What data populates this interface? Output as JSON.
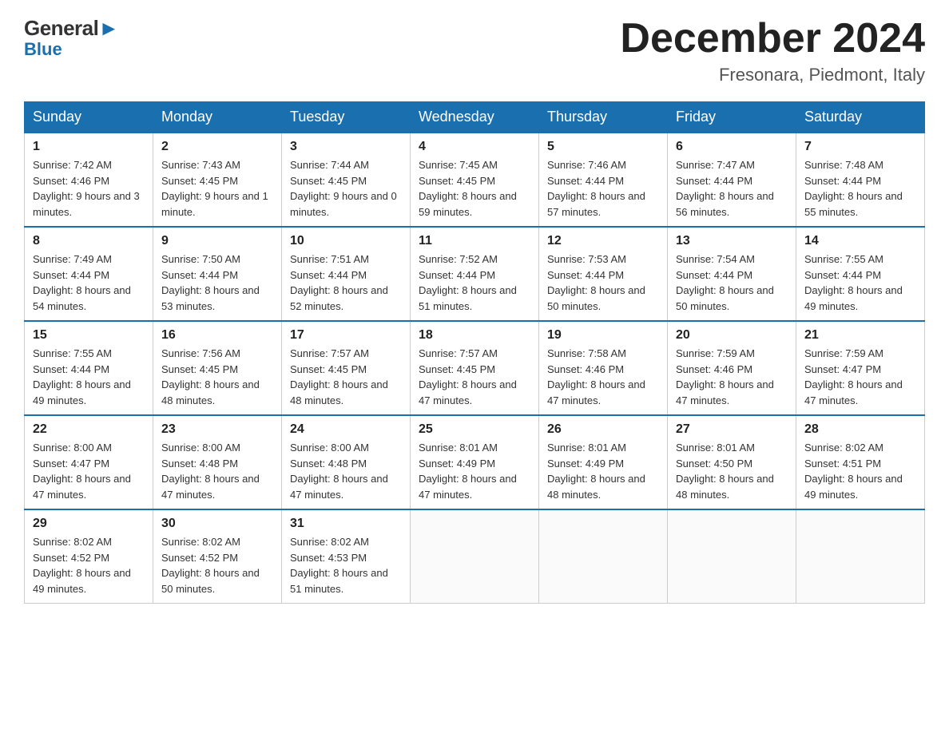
{
  "logo": {
    "line1": "General",
    "line2": "Blue"
  },
  "title": {
    "month_year": "December 2024",
    "location": "Fresonara, Piedmont, Italy"
  },
  "days_of_week": [
    "Sunday",
    "Monday",
    "Tuesday",
    "Wednesday",
    "Thursday",
    "Friday",
    "Saturday"
  ],
  "weeks": [
    [
      {
        "day": "1",
        "sunrise": "7:42 AM",
        "sunset": "4:46 PM",
        "daylight": "9 hours and 3 minutes."
      },
      {
        "day": "2",
        "sunrise": "7:43 AM",
        "sunset": "4:45 PM",
        "daylight": "9 hours and 1 minute."
      },
      {
        "day": "3",
        "sunrise": "7:44 AM",
        "sunset": "4:45 PM",
        "daylight": "9 hours and 0 minutes."
      },
      {
        "day": "4",
        "sunrise": "7:45 AM",
        "sunset": "4:45 PM",
        "daylight": "8 hours and 59 minutes."
      },
      {
        "day": "5",
        "sunrise": "7:46 AM",
        "sunset": "4:44 PM",
        "daylight": "8 hours and 57 minutes."
      },
      {
        "day": "6",
        "sunrise": "7:47 AM",
        "sunset": "4:44 PM",
        "daylight": "8 hours and 56 minutes."
      },
      {
        "day": "7",
        "sunrise": "7:48 AM",
        "sunset": "4:44 PM",
        "daylight": "8 hours and 55 minutes."
      }
    ],
    [
      {
        "day": "8",
        "sunrise": "7:49 AM",
        "sunset": "4:44 PM",
        "daylight": "8 hours and 54 minutes."
      },
      {
        "day": "9",
        "sunrise": "7:50 AM",
        "sunset": "4:44 PM",
        "daylight": "8 hours and 53 minutes."
      },
      {
        "day": "10",
        "sunrise": "7:51 AM",
        "sunset": "4:44 PM",
        "daylight": "8 hours and 52 minutes."
      },
      {
        "day": "11",
        "sunrise": "7:52 AM",
        "sunset": "4:44 PM",
        "daylight": "8 hours and 51 minutes."
      },
      {
        "day": "12",
        "sunrise": "7:53 AM",
        "sunset": "4:44 PM",
        "daylight": "8 hours and 50 minutes."
      },
      {
        "day": "13",
        "sunrise": "7:54 AM",
        "sunset": "4:44 PM",
        "daylight": "8 hours and 50 minutes."
      },
      {
        "day": "14",
        "sunrise": "7:55 AM",
        "sunset": "4:44 PM",
        "daylight": "8 hours and 49 minutes."
      }
    ],
    [
      {
        "day": "15",
        "sunrise": "7:55 AM",
        "sunset": "4:44 PM",
        "daylight": "8 hours and 49 minutes."
      },
      {
        "day": "16",
        "sunrise": "7:56 AM",
        "sunset": "4:45 PM",
        "daylight": "8 hours and 48 minutes."
      },
      {
        "day": "17",
        "sunrise": "7:57 AM",
        "sunset": "4:45 PM",
        "daylight": "8 hours and 48 minutes."
      },
      {
        "day": "18",
        "sunrise": "7:57 AM",
        "sunset": "4:45 PM",
        "daylight": "8 hours and 47 minutes."
      },
      {
        "day": "19",
        "sunrise": "7:58 AM",
        "sunset": "4:46 PM",
        "daylight": "8 hours and 47 minutes."
      },
      {
        "day": "20",
        "sunrise": "7:59 AM",
        "sunset": "4:46 PM",
        "daylight": "8 hours and 47 minutes."
      },
      {
        "day": "21",
        "sunrise": "7:59 AM",
        "sunset": "4:47 PM",
        "daylight": "8 hours and 47 minutes."
      }
    ],
    [
      {
        "day": "22",
        "sunrise": "8:00 AM",
        "sunset": "4:47 PM",
        "daylight": "8 hours and 47 minutes."
      },
      {
        "day": "23",
        "sunrise": "8:00 AM",
        "sunset": "4:48 PM",
        "daylight": "8 hours and 47 minutes."
      },
      {
        "day": "24",
        "sunrise": "8:00 AM",
        "sunset": "4:48 PM",
        "daylight": "8 hours and 47 minutes."
      },
      {
        "day": "25",
        "sunrise": "8:01 AM",
        "sunset": "4:49 PM",
        "daylight": "8 hours and 47 minutes."
      },
      {
        "day": "26",
        "sunrise": "8:01 AM",
        "sunset": "4:49 PM",
        "daylight": "8 hours and 48 minutes."
      },
      {
        "day": "27",
        "sunrise": "8:01 AM",
        "sunset": "4:50 PM",
        "daylight": "8 hours and 48 minutes."
      },
      {
        "day": "28",
        "sunrise": "8:02 AM",
        "sunset": "4:51 PM",
        "daylight": "8 hours and 49 minutes."
      }
    ],
    [
      {
        "day": "29",
        "sunrise": "8:02 AM",
        "sunset": "4:52 PM",
        "daylight": "8 hours and 49 minutes."
      },
      {
        "day": "30",
        "sunrise": "8:02 AM",
        "sunset": "4:52 PM",
        "daylight": "8 hours and 50 minutes."
      },
      {
        "day": "31",
        "sunrise": "8:02 AM",
        "sunset": "4:53 PM",
        "daylight": "8 hours and 51 minutes."
      },
      null,
      null,
      null,
      null
    ]
  ]
}
